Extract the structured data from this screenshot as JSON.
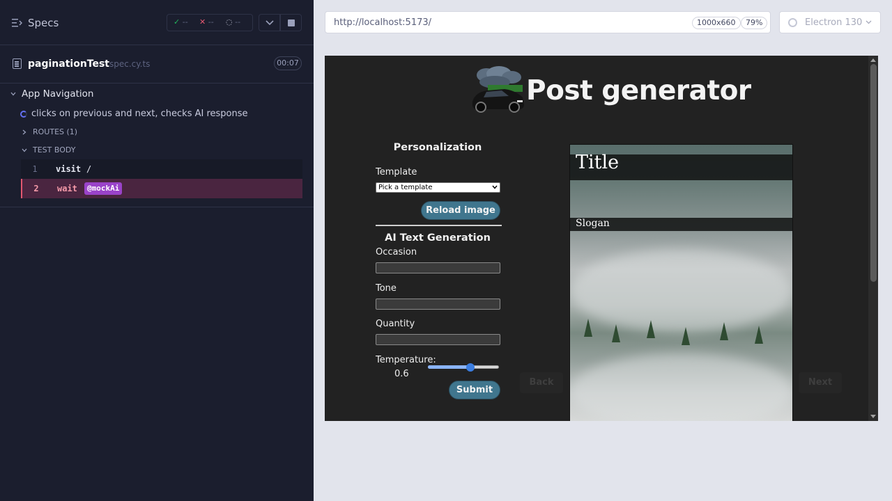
{
  "reporter": {
    "specs_label": "Specs",
    "stats": {
      "passed_symbol": "✓",
      "passed": "--",
      "failed_symbol": "✕",
      "failed": "--",
      "pending_symbol": "◌",
      "pending": "--"
    },
    "file": {
      "name": "paginationTest",
      "ext": "spec.cy.ts",
      "duration": "00:07"
    },
    "suite_title": "App Navigation",
    "test_title": "clicks on previous and next, checks AI response",
    "routes_label": "ROUTES (1)",
    "test_body_label": "TEST BODY",
    "commands": [
      {
        "num": "1",
        "name": "visit",
        "message": "/"
      },
      {
        "num": "2",
        "name": "wait",
        "alias": "@mockAi"
      }
    ]
  },
  "url_bar": {
    "url": "http://localhost:5173/",
    "viewport": "1000x660",
    "zoom": "79%"
  },
  "browser": {
    "label": "Electron 130"
  },
  "app": {
    "title": "Post generator",
    "personalization": {
      "heading": "Personalization",
      "template_label": "Template",
      "template_value": "Pick a template",
      "reload_button": "Reload image"
    },
    "ai": {
      "heading": "AI Text Generation",
      "occasion_label": "Occasion",
      "tone_label": "Tone",
      "quantity_label": "Quantity",
      "temperature_label": "Temperature:",
      "temperature_value": "0.6",
      "submit_button": "Submit"
    },
    "preview": {
      "title": "Title",
      "slogan": "Slogan"
    },
    "back_button": "Back",
    "next_button": "Next"
  }
}
